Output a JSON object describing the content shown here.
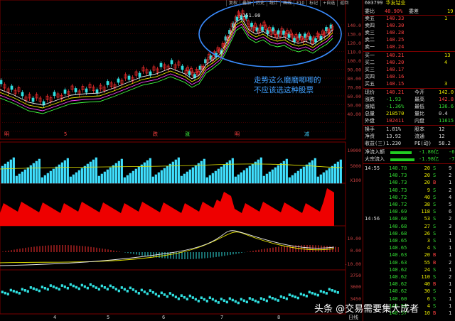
{
  "toolbar": [
    "复权",
    "叠加",
    "历史",
    "统计",
    "画线",
    "F10",
    "标记",
    "+自选",
    "返回"
  ],
  "header": {
    "code": "603799",
    "name": "华友钴业"
  },
  "peak_label": "151.00",
  "annotation": [
    "走势这么磨磨唧唧的",
    "不应该选这种股票"
  ],
  "axis_main": [
    "140.0",
    "130.0",
    "120.0",
    "110.0",
    "100.0",
    "90.00",
    "80.00",
    "70.00",
    "60.00",
    "50.00",
    "40.00"
  ],
  "axis_vol": [
    "10000",
    "5000",
    "X100"
  ],
  "axis_macd": [
    "10.00",
    "0.00",
    "-10.00"
  ],
  "axis_bot": [
    "3750",
    "3600",
    "3450"
  ],
  "date_labels": [
    "4",
    "5",
    "6",
    "7",
    "8"
  ],
  "bottom_label": "日线",
  "event_labels": [
    "明",
    "5",
    "跌",
    "涨",
    "明",
    "减"
  ],
  "watermark": "头条 @交易需要集大成者",
  "quote": {
    "weibi": {
      "label": "委比",
      "v1": "40.90%",
      "label2": "委差",
      "v2": "19"
    },
    "sells": [
      {
        "label": "卖五",
        "price": "140.33",
        "vol": "1"
      },
      {
        "label": "卖四",
        "price": "140.30",
        "vol": ""
      },
      {
        "label": "卖三",
        "price": "140.28",
        "vol": ""
      },
      {
        "label": "卖二",
        "price": "140.25",
        "vol": ""
      },
      {
        "label": "卖一",
        "price": "140.24",
        "vol": ""
      }
    ],
    "buys": [
      {
        "label": "买一",
        "price": "140.21",
        "vol": "13"
      },
      {
        "label": "买二",
        "price": "140.20",
        "vol": "4"
      },
      {
        "label": "买三",
        "price": "140.17",
        "vol": ""
      },
      {
        "label": "买四",
        "price": "140.16",
        "vol": ""
      },
      {
        "label": "买五",
        "price": "140.15",
        "vol": "3"
      }
    ],
    "stats": [
      {
        "l1": "现价",
        "v1": "140.21",
        "l2": "今开",
        "v2": "142.0"
      },
      {
        "l1": "涨跌",
        "v1": "-1.93",
        "l2": "最高",
        "v2": "142.8"
      },
      {
        "l1": "涨幅",
        "v1": "-1.36%",
        "l2": "最低",
        "v2": "136.6"
      },
      {
        "l1": "总量",
        "v1": "218570",
        "l2": "量比",
        "v2": "0.4"
      },
      {
        "l1": "外盘",
        "v1": "102411",
        "l2": "内盘",
        "v2": "11615"
      },
      {
        "l1": "换手",
        "v1": "1.81%",
        "l2": "股本",
        "v2": "12"
      },
      {
        "l1": "净资",
        "v1": "13.92",
        "l2": "流通",
        "v2": "12"
      },
      {
        "l1": "收益(三)",
        "v1": "1.230",
        "l2": "PE(动)",
        "v2": "58.2"
      }
    ],
    "flows": [
      {
        "label": "净流入额",
        "value": "-1.86亿",
        "pct": "-6"
      },
      {
        "label": "大宗流入",
        "value": "-1.98亿",
        "pct": "-7"
      }
    ],
    "ticks": [
      {
        "time": "14:55",
        "price": "140.78",
        "vol": "20",
        "bs": "S",
        "n": "9"
      },
      {
        "time": "",
        "price": "140.73",
        "vol": "20",
        "bs": "S",
        "n": "2"
      },
      {
        "time": "",
        "price": "140.73",
        "vol": "20",
        "bs": "B",
        "n": "1"
      },
      {
        "time": "",
        "price": "140.73",
        "vol": "9",
        "bs": "S",
        "n": "2"
      },
      {
        "time": "",
        "price": "140.72",
        "vol": "40",
        "bs": "S",
        "n": "4"
      },
      {
        "time": "",
        "price": "140.72",
        "vol": "38",
        "bs": "S",
        "n": "5"
      },
      {
        "time": "",
        "price": "140.69",
        "vol": "118",
        "bs": "S",
        "n": "6"
      },
      {
        "time": "14:56",
        "price": "140.68",
        "vol": "53",
        "bs": "S",
        "n": "2"
      },
      {
        "time": "",
        "price": "140.68",
        "vol": "27",
        "bs": "S",
        "n": "3"
      },
      {
        "time": "",
        "price": "140.68",
        "vol": "26",
        "bs": "S",
        "n": "1"
      },
      {
        "time": "",
        "price": "140.65",
        "vol": "3",
        "bs": "S",
        "n": "1"
      },
      {
        "time": "",
        "price": "140.65",
        "vol": "4",
        "bs": "S",
        "n": "1"
      },
      {
        "time": "",
        "price": "140.63",
        "vol": "20",
        "bs": "B",
        "n": "1"
      },
      {
        "time": "",
        "price": "140.63",
        "vol": "55",
        "bs": "B",
        "n": "2"
      },
      {
        "time": "",
        "price": "140.62",
        "vol": "24",
        "bs": "S",
        "n": "1"
      },
      {
        "time": "",
        "price": "140.62",
        "vol": "110",
        "bs": "S",
        "n": "2"
      },
      {
        "time": "",
        "price": "140.62",
        "vol": "40",
        "bs": "B",
        "n": "1"
      },
      {
        "time": "",
        "price": "140.62",
        "vol": "30",
        "bs": "S",
        "n": "1"
      },
      {
        "time": "",
        "price": "140.60",
        "vol": "6",
        "bs": "S",
        "n": "1"
      },
      {
        "time": "",
        "price": "140.58",
        "vol": "4",
        "bs": "S",
        "n": "1"
      },
      {
        "time": "",
        "price": "140.57",
        "vol": "10",
        "bs": "B",
        "n": "1"
      }
    ]
  }
}
